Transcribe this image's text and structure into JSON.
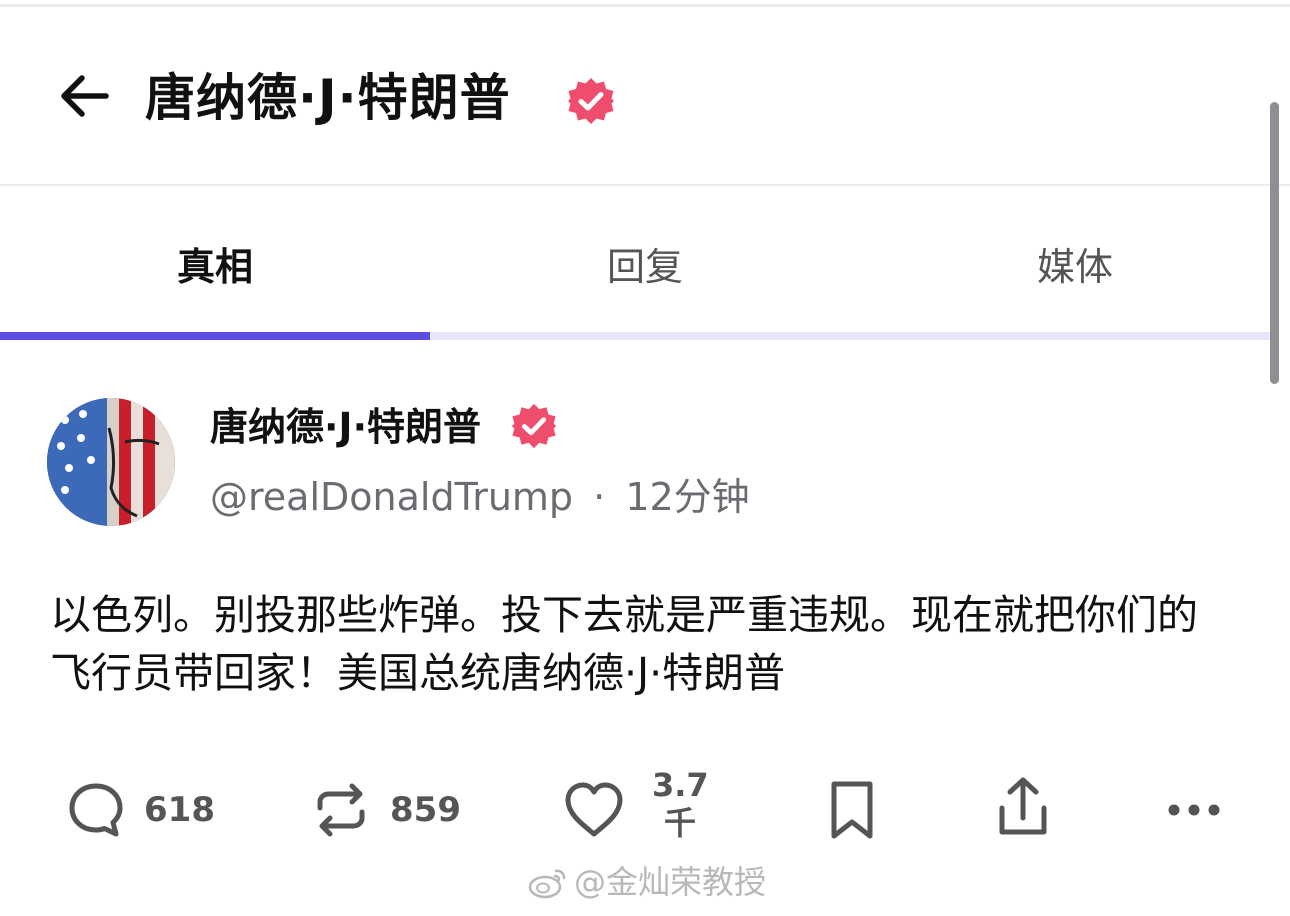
{
  "header": {
    "title": "唐纳德·J·特朗普"
  },
  "tabs": [
    {
      "label": "真相"
    },
    {
      "label": "回复"
    },
    {
      "label": "媒体"
    }
  ],
  "post": {
    "author_name": "唐纳德·J·特朗普",
    "handle": "@realDonaldTrump",
    "separator": "·",
    "time": "12分钟",
    "text": "以色列。别投那些炸弹。投下去就是严重违规。现在就把你们的飞行员带回家！美国总统唐纳德·J·特朗普",
    "actions": {
      "comments": "618",
      "reposts": "859",
      "likes_number": "3.7",
      "likes_unit": "千"
    }
  },
  "watermark": "@金灿荣教授",
  "colors": {
    "accent": "#5a4ee0",
    "verified": "#ee4d6e",
    "muted": "#6b6b72"
  },
  "icons": [
    "back-arrow-icon",
    "verified-badge-icon",
    "comment-icon",
    "repost-icon",
    "heart-icon",
    "bookmark-icon",
    "share-icon",
    "more-icon",
    "weibo-logo-icon"
  ]
}
